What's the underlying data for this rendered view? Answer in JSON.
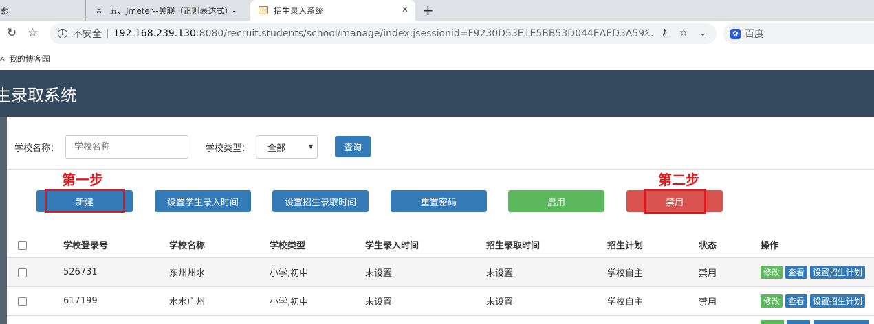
{
  "browser": {
    "tabs": [
      {
        "title": "索"
      },
      {
        "title": "五、Jmeter--关联（正则表达式）- "
      },
      {
        "title": "招生录入系统"
      }
    ],
    "address": {
      "security_label": "不安全",
      "host": "192.168.239.130",
      "rest": ":8080/recruit.students/school/manage/index;jsessionid=F9230D53E1E5BB53D044EAED3A59..."
    },
    "search_engine": "百度",
    "bookmarks": [
      {
        "label": "我的博客园"
      }
    ]
  },
  "app": {
    "title": "生录取系统"
  },
  "search_form": {
    "school_name_label": "学校名称：",
    "school_name_placeholder": "学校名称",
    "school_type_label": "学校类型：",
    "school_type_value": "全部",
    "query_button": "查询"
  },
  "actions": {
    "new": "新建",
    "set_student_time": "设置学生录入时间",
    "set_admission_time": "设置招生录取时间",
    "reset_password": "重置密码",
    "enable": "启用",
    "disable": "禁用"
  },
  "annotations": {
    "step1": "第一步",
    "step2": "第二步"
  },
  "table": {
    "columns": [
      "学校登录号",
      "学校名称",
      "学校类型",
      "学生录入时间",
      "招生录取时间",
      "招生计划",
      "状态",
      "操作"
    ],
    "rows": [
      {
        "login": "526731",
        "name": "东州州水",
        "type": "小学,初中",
        "student_time": "未设置",
        "admission_time": "未设置",
        "plan": "学校自主",
        "status": "禁用"
      },
      {
        "login": "617199",
        "name": "水水广州",
        "type": "小学,初中",
        "student_time": "未设置",
        "admission_time": "未设置",
        "plan": "学校自主",
        "status": "禁用"
      }
    ],
    "row_actions": {
      "edit": "修改",
      "view": "查看",
      "set_plan": "设置招生计划"
    }
  }
}
